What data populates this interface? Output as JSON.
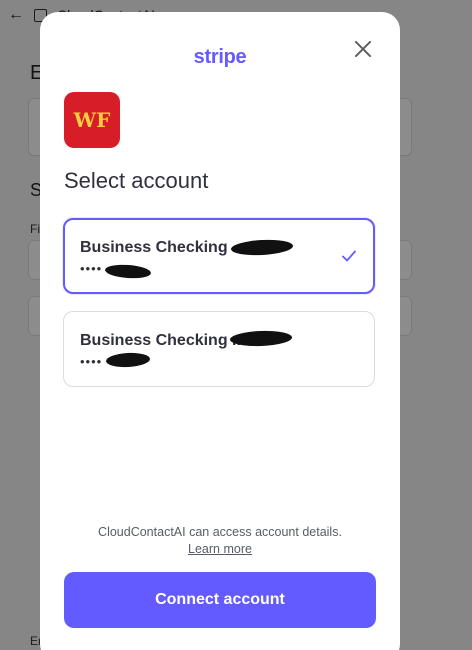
{
  "background": {
    "app_title": "CloudContactAI",
    "heading_fragment_1": "E",
    "heading_fragment_2": "S",
    "label_fragment": "Fi",
    "footer_fragment": "En"
  },
  "modal": {
    "brand": "stripe",
    "institution_logo_text": "WF",
    "title": "Select account",
    "accounts": [
      {
        "name": "Business Checking ..",
        "mask": "••••",
        "selected": true
      },
      {
        "name": "Business Checking ..",
        "mask": "••••",
        "selected": false
      }
    ],
    "consent_text": "CloudContactAI can access account details.",
    "consent_link": "Learn more",
    "connect_button": "Connect account",
    "colors": {
      "accent": "#635bff",
      "institution_red": "#d71e28",
      "institution_gold": "#ffcd41"
    }
  }
}
